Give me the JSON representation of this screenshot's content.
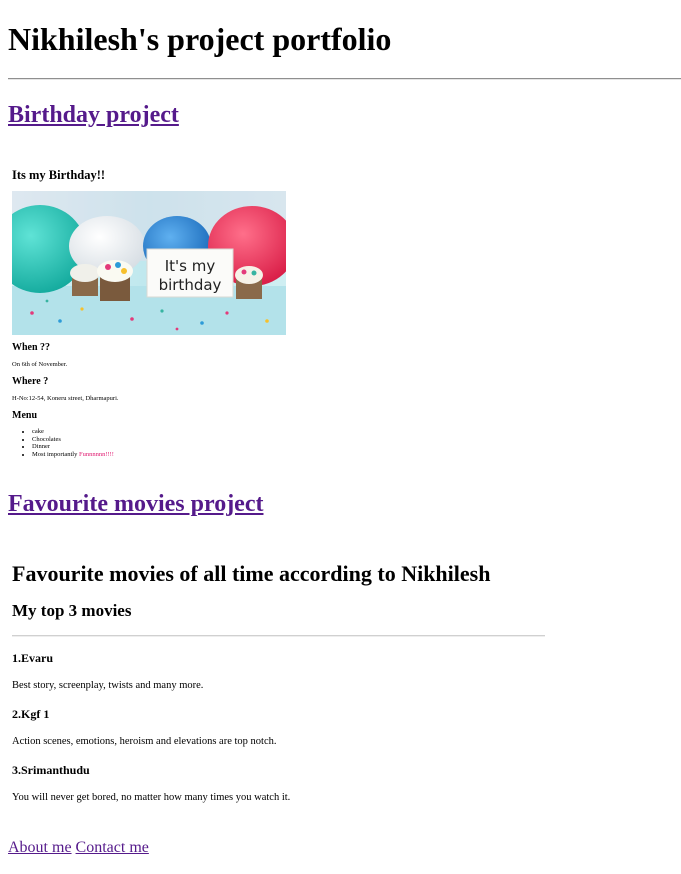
{
  "page": {
    "title": "Nikhilesh's project portfolio"
  },
  "projects": {
    "birthday_link": "Birthday project",
    "movies_link": "Favourite movies project"
  },
  "birthday": {
    "heading": "Its my Birthday!!",
    "image_text": [
      "It's my",
      "birthday"
    ],
    "when_heading": "When ??",
    "when_text": "On 6th of November.",
    "where_heading": "Where ?",
    "where_text": "H-No:12-54, Koneru street, Dharmapuri.",
    "menu_heading": "Menu",
    "menu_items": [
      "cake",
      "Chocolates",
      "Dinner"
    ],
    "menu_last_prefix": "Most importantly ",
    "menu_last_highlight": "Funnnnnn!!!!",
    "highlight_color": "#e0156e"
  },
  "movies": {
    "heading": "Favourite movies of all time according to Nikhilesh",
    "subheading": "My top 3 movies",
    "items": [
      {
        "title": "1.Evaru",
        "description": "Best story, screenplay, twists and many more."
      },
      {
        "title": "2.Kgf 1",
        "description": "Action scenes, emotions, heroism and elevations are top notch."
      },
      {
        "title": "3.Srimanthudu",
        "description": "You will never get bored, no matter how many times you watch it."
      }
    ]
  },
  "footer": {
    "about_link": "About me",
    "contact_link": "Contact me"
  },
  "colors": {
    "link": "#551a8b",
    "text": "#000000",
    "background": "#ffffff"
  }
}
